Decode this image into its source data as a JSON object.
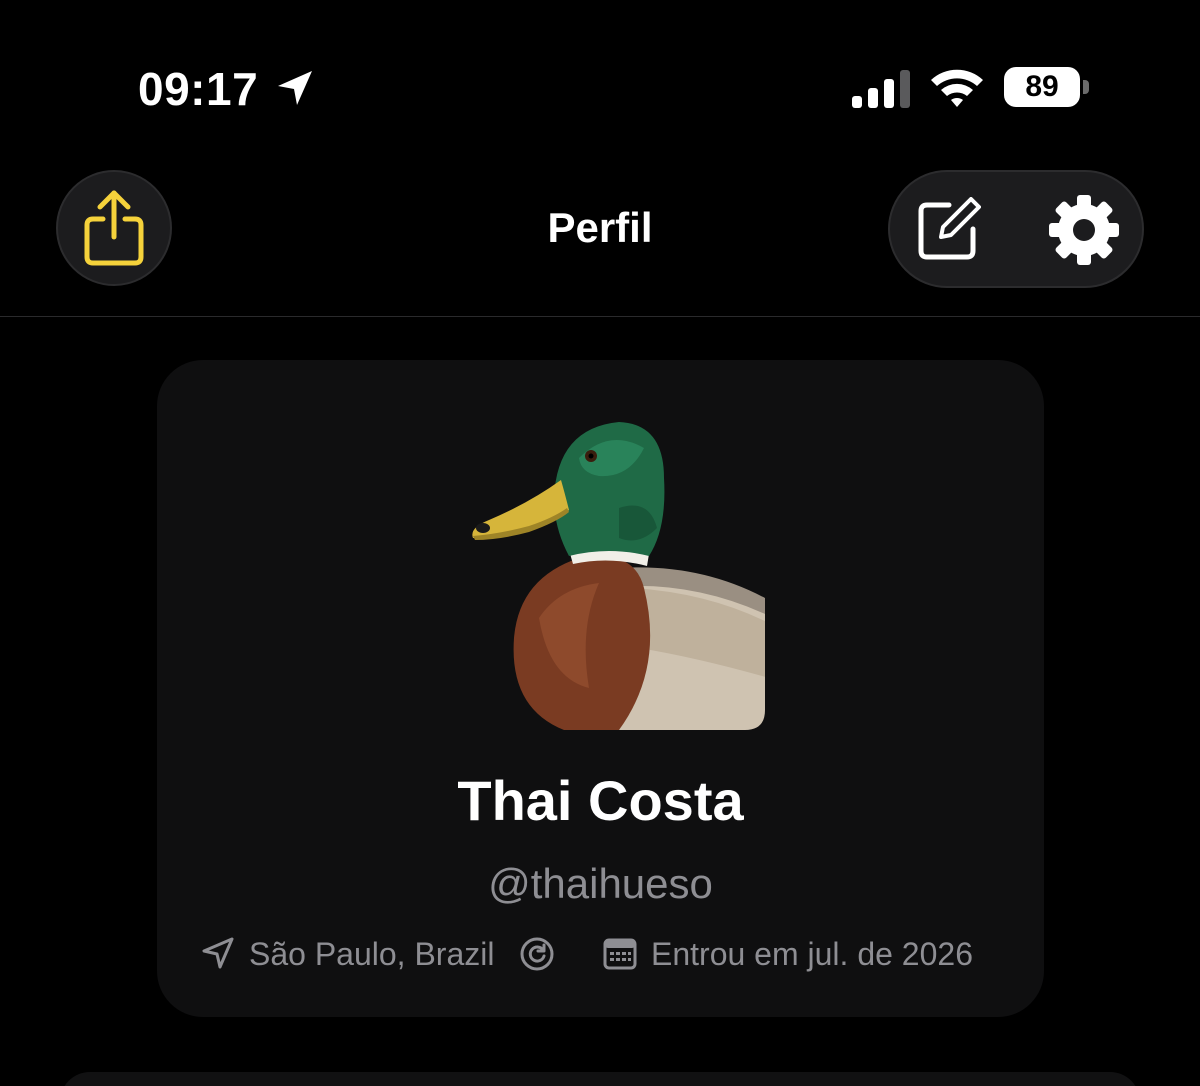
{
  "status_bar": {
    "time": "09:17",
    "battery_level": "89",
    "icons": [
      "location-arrow-icon",
      "cellular-signal-icon",
      "wifi-icon",
      "battery-icon"
    ]
  },
  "nav": {
    "title": "Perfil",
    "share_icon": "share-icon",
    "edit_icon": "compose-icon",
    "settings_icon": "gear-icon",
    "accent_color": "#F5D23B"
  },
  "profile": {
    "name": "Thai Costa",
    "handle": "@thaihueso",
    "avatar": "mallard-duck-avatar",
    "location": "São Paulo, Brazil",
    "joined": "Entrou em jul. de 2026",
    "meta_icons": [
      "location-arrow-icon",
      "refresh-icon",
      "calendar-icon"
    ]
  }
}
